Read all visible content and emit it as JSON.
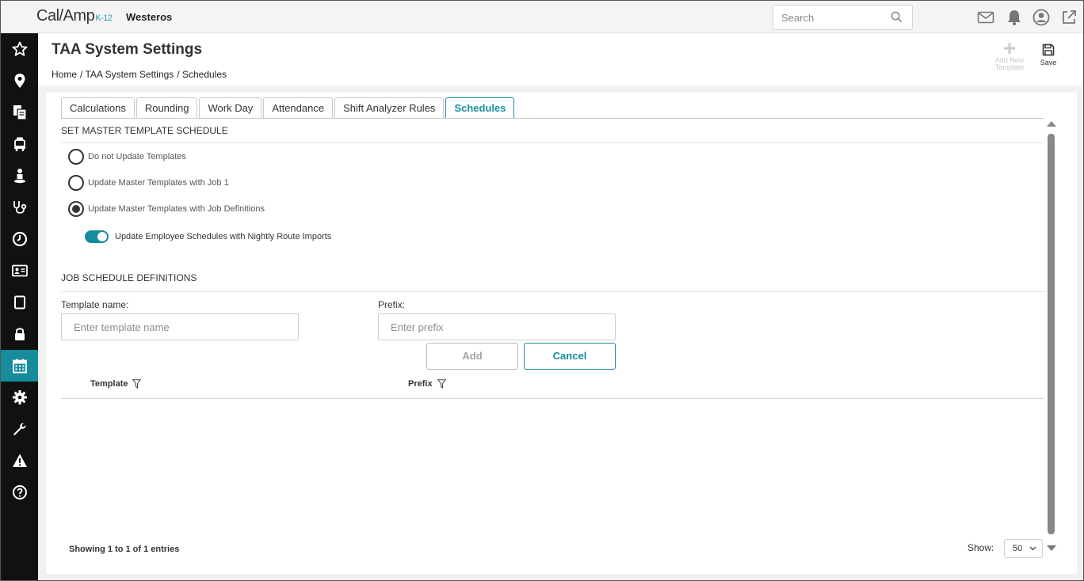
{
  "app": {
    "logo_main": "Cal/Amp",
    "logo_sub": "K-12",
    "org_name": "Westeros",
    "search_placeholder": "Search"
  },
  "top_icons": [
    "mail-icon",
    "bell-icon",
    "user-circle-icon",
    "external-link-icon"
  ],
  "sidebar": {
    "items": [
      {
        "name": "star-icon"
      },
      {
        "name": "location-pin-icon"
      },
      {
        "name": "documents-icon"
      },
      {
        "name": "vehicle-icon"
      },
      {
        "name": "person-icon"
      },
      {
        "name": "stethoscope-icon"
      },
      {
        "name": "clock-icon"
      },
      {
        "name": "id-card-icon"
      },
      {
        "name": "tablet-icon"
      },
      {
        "name": "lock-icon"
      },
      {
        "name": "calendar-icon",
        "active": true
      },
      {
        "name": "gear-icon"
      },
      {
        "name": "wrench-icon"
      },
      {
        "name": "warning-icon"
      },
      {
        "name": "help-icon"
      }
    ],
    "active_color": "#178c9c"
  },
  "page": {
    "title": "TAA System Settings",
    "breadcrumb": [
      "Home",
      "/ TAA System Settings",
      "/ Schedules"
    ],
    "actions": {
      "add_template_label": "Add New Template",
      "save_label": "Save"
    }
  },
  "tabs": [
    {
      "label": "Calculations"
    },
    {
      "label": "Rounding"
    },
    {
      "label": "Work Day"
    },
    {
      "label": "Attendance"
    },
    {
      "label": "Shift Analyzer Rules"
    },
    {
      "label": "Schedules",
      "active": true
    }
  ],
  "master_schedule": {
    "heading": "SET MASTER TEMPLATE SCHEDULE",
    "options": [
      {
        "label": "Do not Update Templates",
        "checked": false
      },
      {
        "label": "Update Master Templates with Job 1",
        "checked": false
      },
      {
        "label": "Update Master Templates with Job Definitions",
        "checked": true
      }
    ],
    "toggle_label": "Update Employee Schedules with Nightly Route Imports",
    "toggle_on": true
  },
  "job_definitions": {
    "heading": "JOB SCHEDULE DEFINITIONS",
    "template_label": "Template name:",
    "template_placeholder": "Enter template name",
    "template_value": "",
    "prefix_label": "Prefix:",
    "prefix_placeholder": "Enter prefix",
    "prefix_value": "",
    "add_label": "Add",
    "cancel_label": "Cancel",
    "columns": [
      "Template",
      "Prefix"
    ],
    "rows": []
  },
  "footer": {
    "entries_text": "Showing 1 to 1 of 1 entries",
    "show_label": "Show:",
    "page_size": "50"
  }
}
